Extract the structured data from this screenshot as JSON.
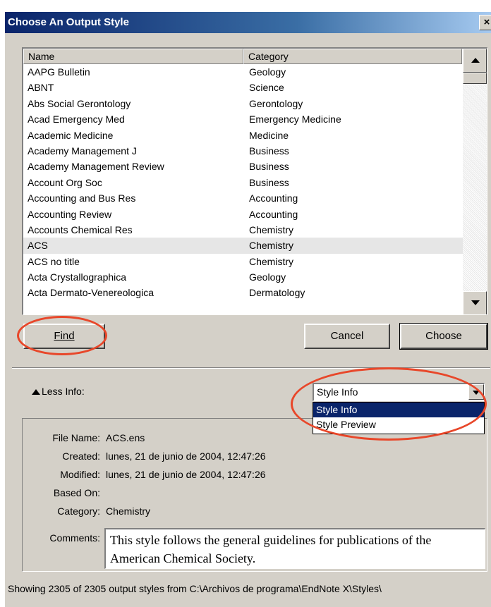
{
  "window": {
    "title": "Choose An Output Style",
    "close_glyph": "×"
  },
  "list": {
    "headers": {
      "name": "Name",
      "category": "Category"
    },
    "rows": [
      {
        "name": "AAPG Bulletin",
        "category": "Geology"
      },
      {
        "name": "ABNT",
        "category": "Science"
      },
      {
        "name": "Abs Social Gerontology",
        "category": "Gerontology"
      },
      {
        "name": "Acad Emergency Med",
        "category": "Emergency Medicine"
      },
      {
        "name": "Academic Medicine",
        "category": "Medicine"
      },
      {
        "name": "Academy Management J",
        "category": "Business"
      },
      {
        "name": "Academy Management Review",
        "category": "Business"
      },
      {
        "name": "Account Org Soc",
        "category": "Business"
      },
      {
        "name": "Accounting and Bus Res",
        "category": "Accounting"
      },
      {
        "name": "Accounting Review",
        "category": "Accounting"
      },
      {
        "name": "Accounts Chemical Res",
        "category": "Chemistry"
      },
      {
        "name": "ACS",
        "category": "Chemistry"
      },
      {
        "name": "ACS no title",
        "category": "Chemistry"
      },
      {
        "name": "Acta Crystallographica",
        "category": "Geology"
      },
      {
        "name": "Acta Dermato-Venereologica",
        "category": "Dermatology"
      }
    ],
    "selected_index": 11
  },
  "buttons": {
    "find": "Find",
    "cancel": "Cancel",
    "choose": "Choose"
  },
  "less_info_label": "Less Info:",
  "view_select": {
    "value": "Style Info",
    "options": [
      "Style Info",
      "Style Preview"
    ]
  },
  "info": {
    "file_name_label": "File Name:",
    "file_name": "ACS.ens",
    "created_label": "Created:",
    "created": "lunes, 21 de junio de 2004, 12:47:26",
    "modified_label": "Modified:",
    "modified": "lunes, 21 de junio de 2004, 12:47:26",
    "based_on_label": "Based On:",
    "based_on": "",
    "category_label": "Category:",
    "category": "Chemistry",
    "comments_label": "Comments:",
    "comments": "This style follows the general guidelines for publications of the American Chemical Society."
  },
  "status": "Showing 2305 of 2305 output styles from C:\\Archivos de programa\\EndNote X\\Styles\\",
  "colors": {
    "annotation": "#e8472a",
    "selection": "#0a246a",
    "face": "#d4d0c8"
  }
}
